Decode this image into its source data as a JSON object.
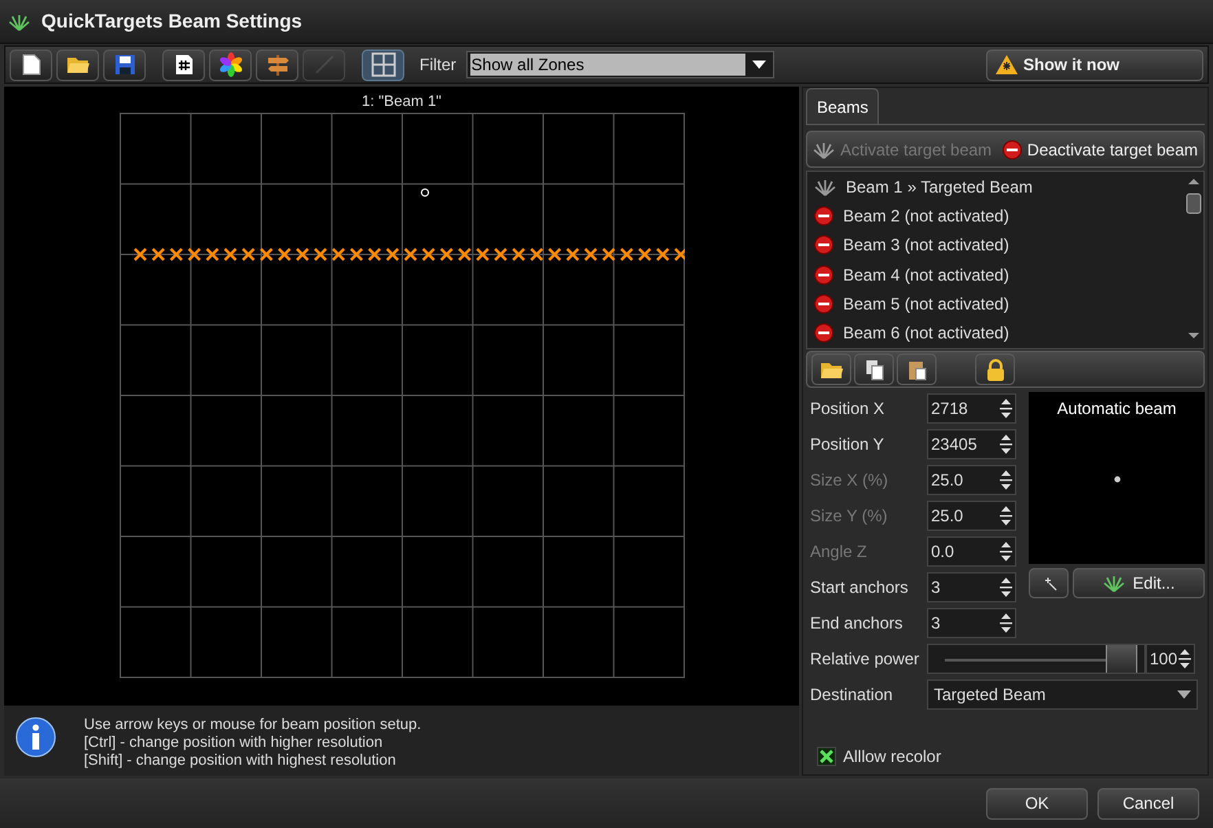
{
  "window": {
    "title": "QuickTargets Beam Settings"
  },
  "toolbar": {
    "buttons": [
      {
        "selected": false,
        "disabled": false
      },
      {
        "selected": false,
        "disabled": false
      },
      {
        "selected": false,
        "disabled": false
      },
      {
        "selected": false,
        "disabled": false
      },
      {
        "selected": false,
        "disabled": false
      },
      {
        "selected": false,
        "disabled": false
      },
      {
        "selected": false,
        "disabled": true
      },
      {
        "selected": true,
        "disabled": false
      }
    ],
    "filter_label": "Filter",
    "filter_value": "Show all Zones",
    "show_button": "Show it now"
  },
  "canvas": {
    "title": "1: \"Beam 1\""
  },
  "info": {
    "lines": [
      "Use arrow keys or mouse for beam position setup.",
      "[Ctrl] - change position with higher resolution",
      "[Shift] - change position with highest resolution"
    ]
  },
  "tabs": [
    {
      "label": "Beams",
      "selected": true
    }
  ],
  "beam_actions": [
    {
      "label": "Activate target beam",
      "disabled": true
    },
    {
      "label": "Deactivate target beam",
      "disabled": false
    }
  ],
  "beams": [
    {
      "label": "Beam 1 » Targeted Beam",
      "activated": true
    },
    {
      "label": "Beam 2 (not activated)",
      "activated": false
    },
    {
      "label": "Beam 3 (not activated)",
      "activated": false
    },
    {
      "label": "Beam 4 (not activated)",
      "activated": false
    },
    {
      "label": "Beam 5 (not activated)",
      "activated": false
    },
    {
      "label": "Beam 6 (not activated)",
      "activated": false
    }
  ],
  "fields": [
    {
      "label": "Position X",
      "value": "2718",
      "disabled": false
    },
    {
      "label": "Position Y",
      "value": "23405",
      "disabled": false
    },
    {
      "label": "Size X (%)",
      "value": "25.0",
      "disabled": true
    },
    {
      "label": "Size Y (%)",
      "value": "25.0",
      "disabled": true
    },
    {
      "label": "Angle Z",
      "value": "0.0",
      "disabled": true
    },
    {
      "label": "Start anchors",
      "value": "3",
      "disabled": false
    },
    {
      "label": "End anchors",
      "value": "3",
      "disabled": false
    }
  ],
  "preview": {
    "title": "Automatic beam",
    "edit_button": "Edit..."
  },
  "relative_power": {
    "label": "Relative power",
    "level": 0.95,
    "value": "100"
  },
  "destination": {
    "label": "Destination",
    "value": "Targeted Beam"
  },
  "allow_recolor": {
    "label": "Alllow recolor",
    "checked": true
  },
  "footer": {
    "buttons": [
      "OK",
      "Cancel"
    ]
  }
}
